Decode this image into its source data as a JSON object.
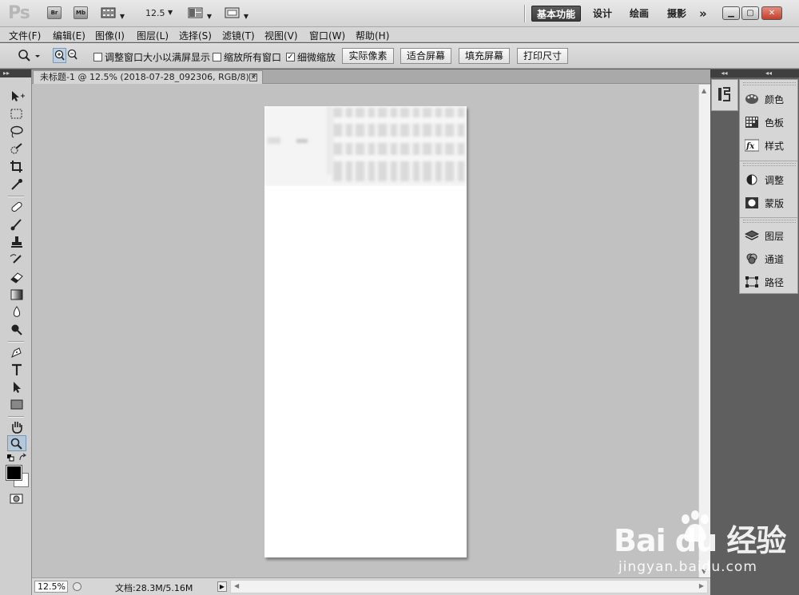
{
  "appbar": {
    "logo": "Ps",
    "bridge_label": "Br",
    "minibridge_label": "Mb",
    "zoom_value": "12.5",
    "workspaces": [
      "基本功能",
      "设计",
      "绘画",
      "摄影"
    ],
    "more": "»"
  },
  "menu": [
    "文件(F)",
    "编辑(E)",
    "图像(I)",
    "图层(L)",
    "选择(S)",
    "滤镜(T)",
    "视图(V)",
    "窗口(W)",
    "帮助(H)"
  ],
  "options": {
    "resize_windows": {
      "label": "调整窗口大小以满屏显示",
      "checked": false
    },
    "zoom_all": {
      "label": "缩放所有窗口",
      "checked": false
    },
    "scrubby_zoom": {
      "label": "细微缩放",
      "checked": true
    },
    "buttons": [
      "实际像素",
      "适合屏幕",
      "填充屏幕",
      "打印尺寸"
    ]
  },
  "document": {
    "tab_title": "未标题-1 @ 12.5% (2018-07-28_092306, RGB/8) *",
    "close_glyph": "×"
  },
  "status": {
    "zoom": "12.5%",
    "doc_size": "文档:28.3M/5.16M"
  },
  "panels": {
    "group1": [
      "颜色",
      "色板",
      "样式"
    ],
    "group2": [
      "调整",
      "蒙版"
    ],
    "group3": [
      "图层",
      "通道",
      "路径"
    ]
  },
  "watermark": {
    "main": "Bai du 经验",
    "sub": "jingyan.baidu.com"
  },
  "colors": {
    "foreground": "#000000",
    "background": "#ffffff",
    "workspace_active": "#3c3c3c",
    "canvas_bg": "#c1c1c1"
  }
}
